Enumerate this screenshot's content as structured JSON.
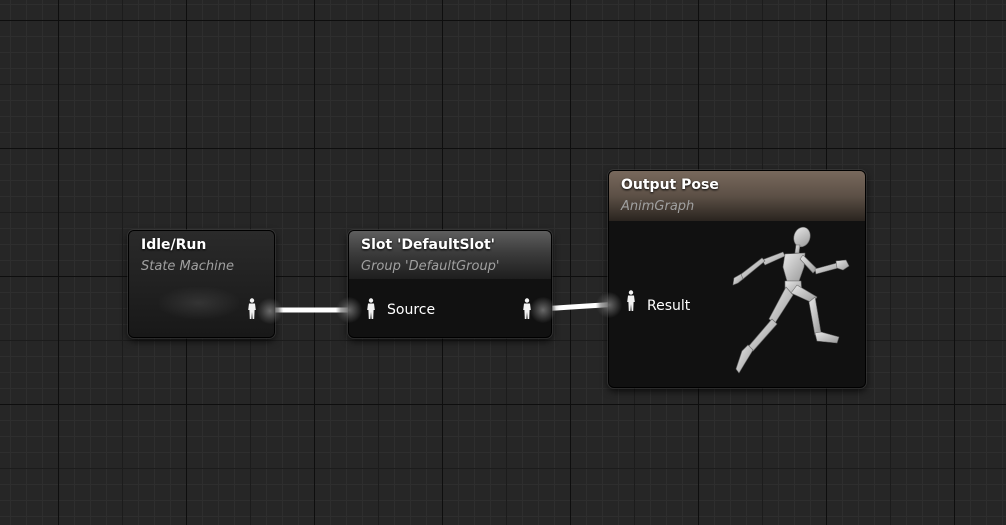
{
  "graph": {
    "name": "AnimGraph"
  },
  "nodes": {
    "idle_run": {
      "title": "Idle/Run",
      "subtitle": "State Machine"
    },
    "slot": {
      "title": "Slot 'DefaultSlot'",
      "subtitle": "Group 'DefaultGroup'",
      "input_pin": "Source"
    },
    "output_pose": {
      "title": "Output Pose",
      "subtitle": "AnimGraph",
      "input_pin": "Result"
    }
  },
  "icons": {
    "pose_pin": "pose-pin-icon",
    "hero": "running-mannequin-icon"
  },
  "colors": {
    "graph_background": "#262626",
    "node_body": "#111111",
    "wire": "#ffffff",
    "output_header": "#6b5e52"
  }
}
